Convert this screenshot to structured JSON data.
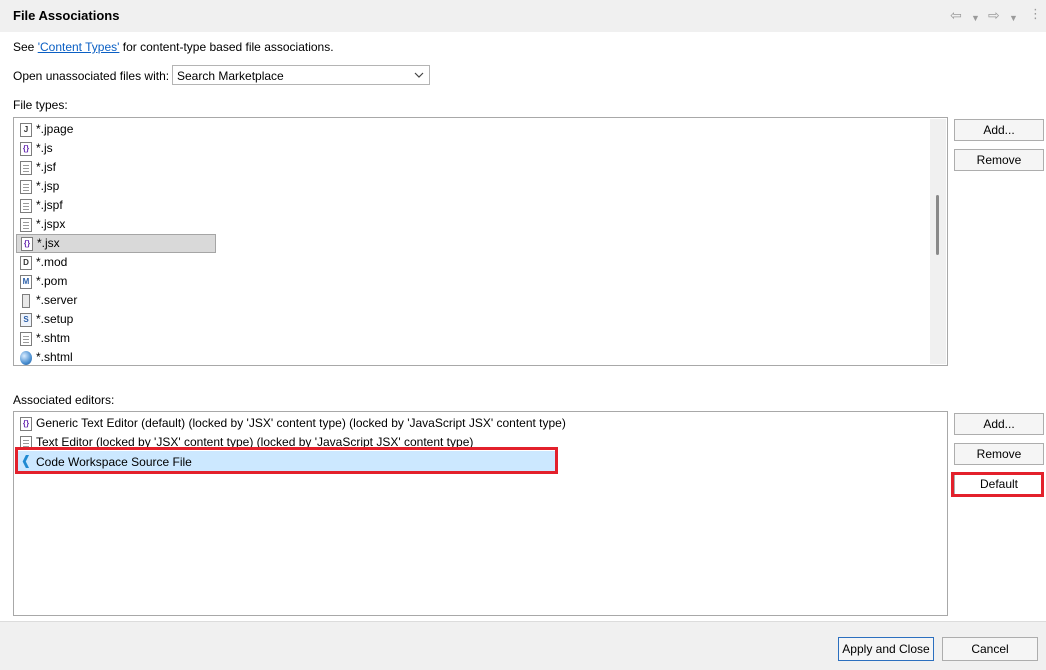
{
  "header": {
    "title": "File Associations",
    "nav_back_icon": "arrow-left-icon",
    "nav_forward_icon": "arrow-right-icon",
    "menu_icon": "kebab-menu-icon"
  },
  "intro": {
    "prefix": "See ",
    "link": "'Content Types'",
    "suffix": " for content-type based file associations."
  },
  "open_unassociated": {
    "label": "Open unassociated files with:",
    "selected": "Search Marketplace"
  },
  "file_types": {
    "label": "File types:",
    "items": [
      {
        "name": "*.jpage",
        "icon": "J"
      },
      {
        "name": "*.js",
        "icon": "{}"
      },
      {
        "name": "*.jsf",
        "icon": "doc"
      },
      {
        "name": "*.jsp",
        "icon": "doc"
      },
      {
        "name": "*.jspf",
        "icon": "doc"
      },
      {
        "name": "*.jspx",
        "icon": "doc"
      },
      {
        "name": "*.jsx",
        "icon": "{}",
        "selected": true
      },
      {
        "name": "*.mod",
        "icon": "D"
      },
      {
        "name": "*.pom",
        "icon": "M"
      },
      {
        "name": "*.server",
        "icon": "server"
      },
      {
        "name": "*.setup",
        "icon": "setup"
      },
      {
        "name": "*.shtm",
        "icon": "doc"
      },
      {
        "name": "*.shtml",
        "icon": "globe"
      }
    ],
    "add_label": "Add...",
    "remove_label": "Remove"
  },
  "editors": {
    "label": "Associated editors:",
    "items": [
      {
        "name": "Generic Text Editor (default) (locked by 'JSX' content type) (locked by 'JavaScript JSX' content type)",
        "icon": "{}"
      },
      {
        "name": "Text Editor (locked by 'JSX' content type) (locked by 'JavaScript JSX' content type)",
        "icon": "doc"
      },
      {
        "name": "Code Workspace Source File",
        "icon": "vscode",
        "selected": true
      }
    ],
    "add_label": "Add...",
    "remove_label": "Remove",
    "default_label": "Default"
  },
  "footer": {
    "apply_label": "Apply and Close",
    "cancel_label": "Cancel"
  },
  "colors": {
    "highlight": "#e3202b",
    "selection": "#cce8ff",
    "link": "#0a5fc4"
  }
}
